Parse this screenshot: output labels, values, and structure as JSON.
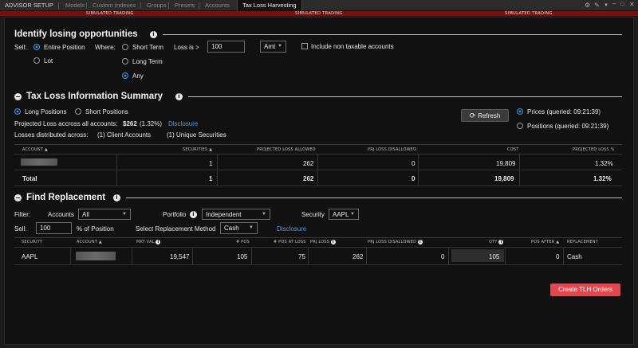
{
  "top_tabs": [
    "ADVISOR SETUP",
    "Models",
    "Custom Indexes",
    "Groups",
    "Presets",
    "Accounts",
    "Tax Loss Harvesting"
  ],
  "simulated_label": "SIMULATED TRADING",
  "identify": {
    "title": "Identify losing opportunities",
    "sell_label": "Sell:",
    "sell_entire": "Entire Position",
    "sell_lot": "Lot",
    "where_label": "Where:",
    "short_term": "Short Term",
    "long_term": "Long Term",
    "any": "Any",
    "loss_label": "Loss is >",
    "loss_value": "100",
    "amt_option": "Amt",
    "include_nontax": "Include non taxable accounts"
  },
  "summary": {
    "title": "Tax Loss Information Summary",
    "long_positions": "Long Positions",
    "short_positions": "Short Positions",
    "projected_loss_label": "Projected Loss accross all accounts:",
    "projected_loss_value": "$262",
    "projected_loss_pct": "(1.32%)",
    "disclosure": "Disclosure",
    "losses_label": "Losses distributed across:",
    "client_accounts": "(1) Client Accounts",
    "unique_securities": "(1) Unique Securities",
    "refresh": "Refresh",
    "prices_queried": "Prices (queried: 09:21:39)",
    "positions_queried": "Positions (queried: 09:21:39)",
    "columns": [
      "ACCOUNT",
      "SECURITIES",
      "PROJECTED LOSS ALLOWED",
      "PRJ LOSS DISALLOWED",
      "COST",
      "PROJECTED LOSS %"
    ],
    "row": {
      "securities": "1",
      "loss_allowed": "262",
      "loss_disallowed": "0",
      "cost": "19,809",
      "loss_pct": "1.32%"
    },
    "total": {
      "label": "Total",
      "securities": "1",
      "loss_allowed": "262",
      "loss_disallowed": "0",
      "cost": "19,809",
      "loss_pct": "1.32%"
    }
  },
  "replacement": {
    "title": "Find Replacement",
    "filter_label": "Filter:",
    "accounts_label": "Accounts",
    "accounts_value": "All",
    "portfolio_label": "Portfolio",
    "portfolio_value": "Independent",
    "security_label": "Security",
    "security_value": "AAPL",
    "sell_label": "Sell:",
    "sell_value": "100",
    "pct_position": "% of Position",
    "method_label": "Select Replacement Method",
    "method_value": "Cash",
    "disclosure": "Disclosure",
    "columns": [
      "SECURITY",
      "ACCOUNT",
      "MKT VAL",
      "# POS",
      "# POS AT LOSS",
      "PRJ LOSS",
      "PRJ LOSS DISALLOWED",
      "QTY",
      "POS AFTER",
      "REPLACEMENT"
    ],
    "row": {
      "security": "AAPL",
      "mkt_val": "19,547",
      "pos": "105",
      "pos_at_loss": "75",
      "prj_loss": "262",
      "prj_loss_disallowed": "0",
      "qty": "105",
      "pos_after": "0",
      "replacement": "Cash"
    },
    "create_button": "Create TLH Orders"
  }
}
